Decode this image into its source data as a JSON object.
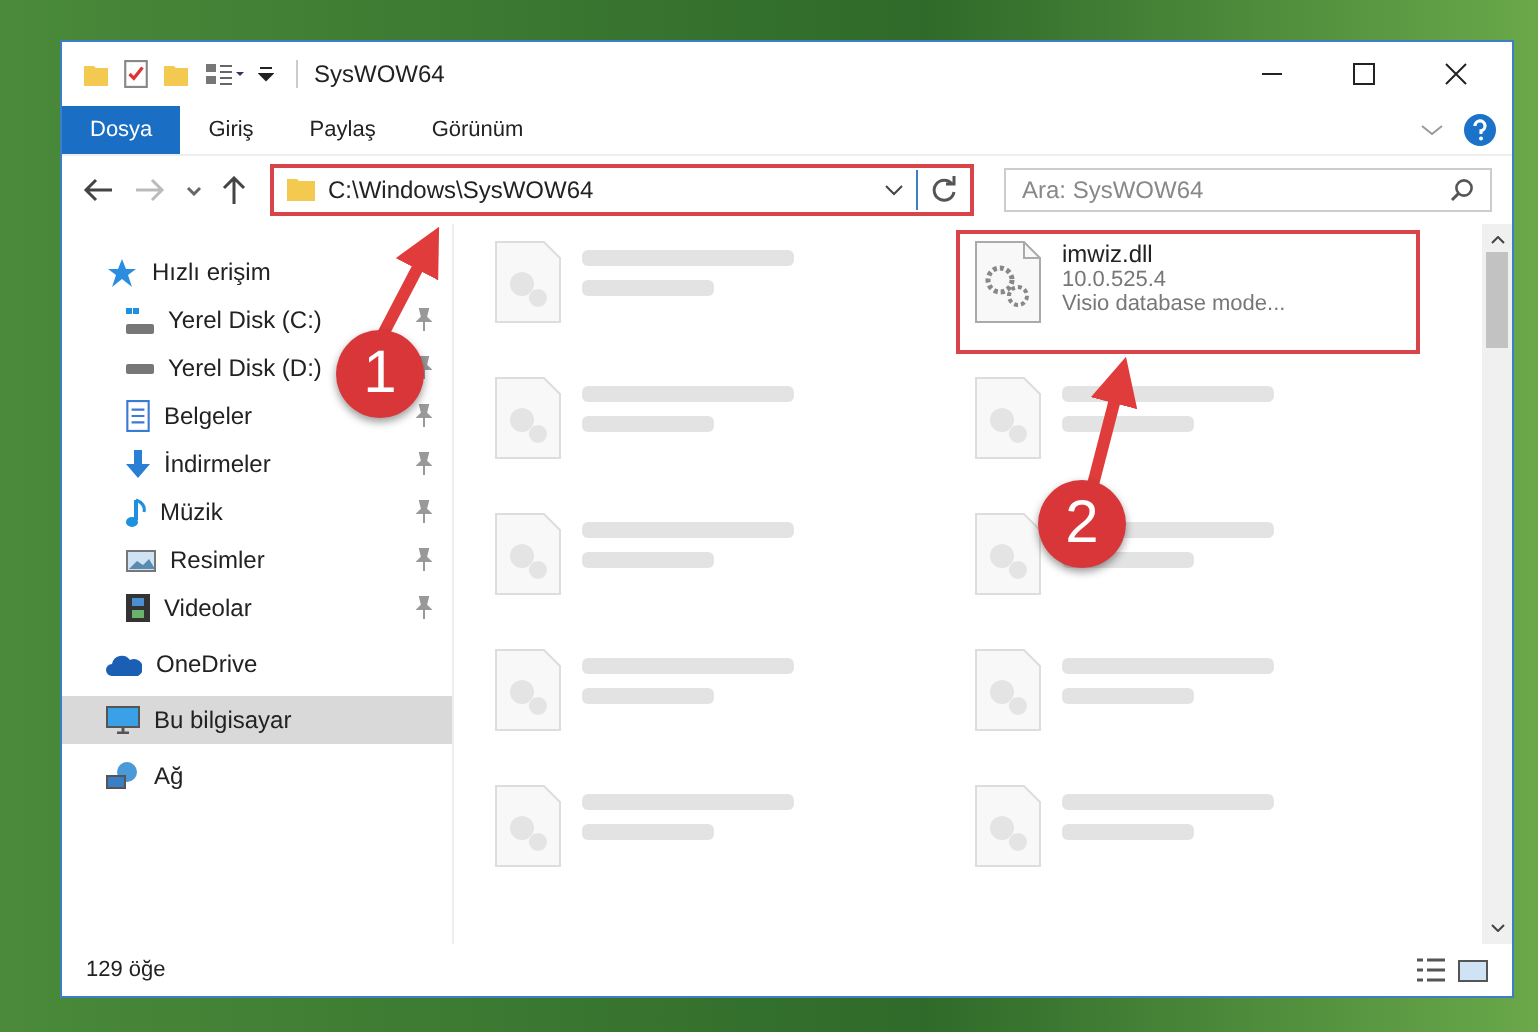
{
  "window": {
    "title": "SysWOW64"
  },
  "ribbon_tabs": [
    {
      "label": "Dosya",
      "selected": true
    },
    {
      "label": "Giriş",
      "selected": false
    },
    {
      "label": "Paylaş",
      "selected": false
    },
    {
      "label": "Görünüm",
      "selected": false
    }
  ],
  "address": {
    "path": "C:\\Windows\\SysWOW64",
    "highlighted": true
  },
  "search": {
    "placeholder": "Ara: SysWOW64"
  },
  "sidebar": {
    "items": [
      {
        "label": "Hızlı erişim",
        "kind": "star",
        "selected": false,
        "children": [
          {
            "label": "Yerel Disk (C:)",
            "kind": "system-drive",
            "pinned": true
          },
          {
            "label": "Yerel Disk (D:)",
            "kind": "drive",
            "pinned": true
          },
          {
            "label": "Belgeler",
            "kind": "document",
            "pinned": true
          },
          {
            "label": "İndirmeler",
            "kind": "download",
            "pinned": true
          },
          {
            "label": "Müzik",
            "kind": "music",
            "pinned": true
          },
          {
            "label": "Resimler",
            "kind": "picture",
            "pinned": true
          },
          {
            "label": "Videolar",
            "kind": "video",
            "pinned": true
          }
        ]
      },
      {
        "label": "OneDrive",
        "kind": "cloud",
        "selected": false
      },
      {
        "label": "Bu bilgisayar",
        "kind": "computer",
        "selected": true
      },
      {
        "label": "Ağ",
        "kind": "network",
        "selected": false
      }
    ]
  },
  "files": [
    {
      "blurred": true
    },
    {
      "name": "imwiz.dll",
      "details": [
        "10.0.525.4",
        "Visio database mode..."
      ],
      "blurred": false,
      "highlighted": true
    },
    {
      "blurred": true
    },
    {
      "blurred": true
    },
    {
      "blurred": true
    },
    {
      "blurred": true
    },
    {
      "blurred": true
    },
    {
      "blurred": true
    },
    {
      "blurred": true
    },
    {
      "blurred": true
    }
  ],
  "status_bar": {
    "count": "129 öğe"
  },
  "callouts": [
    {
      "label": "1"
    },
    {
      "label": "2"
    }
  ]
}
